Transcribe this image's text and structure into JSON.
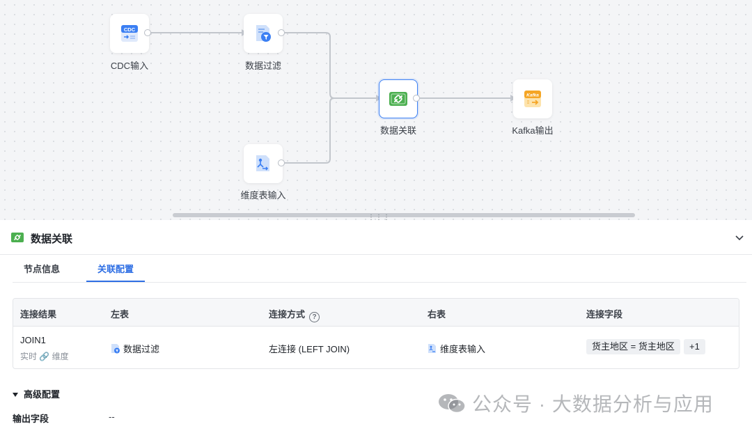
{
  "canvas": {
    "nodes": {
      "cdc": {
        "label": "CDC输入",
        "badge": "CDC",
        "icon": "cdc-input-icon"
      },
      "filter": {
        "label": "数据过滤",
        "icon": "data-filter-icon"
      },
      "join": {
        "label": "数据关联",
        "icon": "data-join-icon"
      },
      "kafka": {
        "label": "Kafka输出",
        "badge": "Kafka",
        "icon": "kafka-output-icon"
      },
      "dim": {
        "label": "维度表输入",
        "icon": "dimension-table-icon"
      }
    },
    "colors": {
      "blue": "#3b7ff3",
      "green": "#4caf50",
      "orange": "#f5a524"
    }
  },
  "panel": {
    "title": "数据关联",
    "tabs": [
      "节点信息",
      "关联配置"
    ],
    "active_tab": "关联配置",
    "table": {
      "headers": [
        "连接结果",
        "左表",
        "连接方式",
        "右表",
        "连接字段"
      ],
      "row": {
        "result": "JOIN1",
        "result_sub_left": "实时",
        "result_sub_right": "维度",
        "left_table": "数据过滤",
        "join_type": "左连接 (LEFT JOIN)",
        "right_table": "维度表输入",
        "field": "货主地区 = 货主地区",
        "more": "+1"
      }
    },
    "advanced": {
      "title": "高级配置",
      "output_label": "输出字段",
      "output_value": "--"
    }
  },
  "watermark": "公众号 · 大数据分析与应用"
}
